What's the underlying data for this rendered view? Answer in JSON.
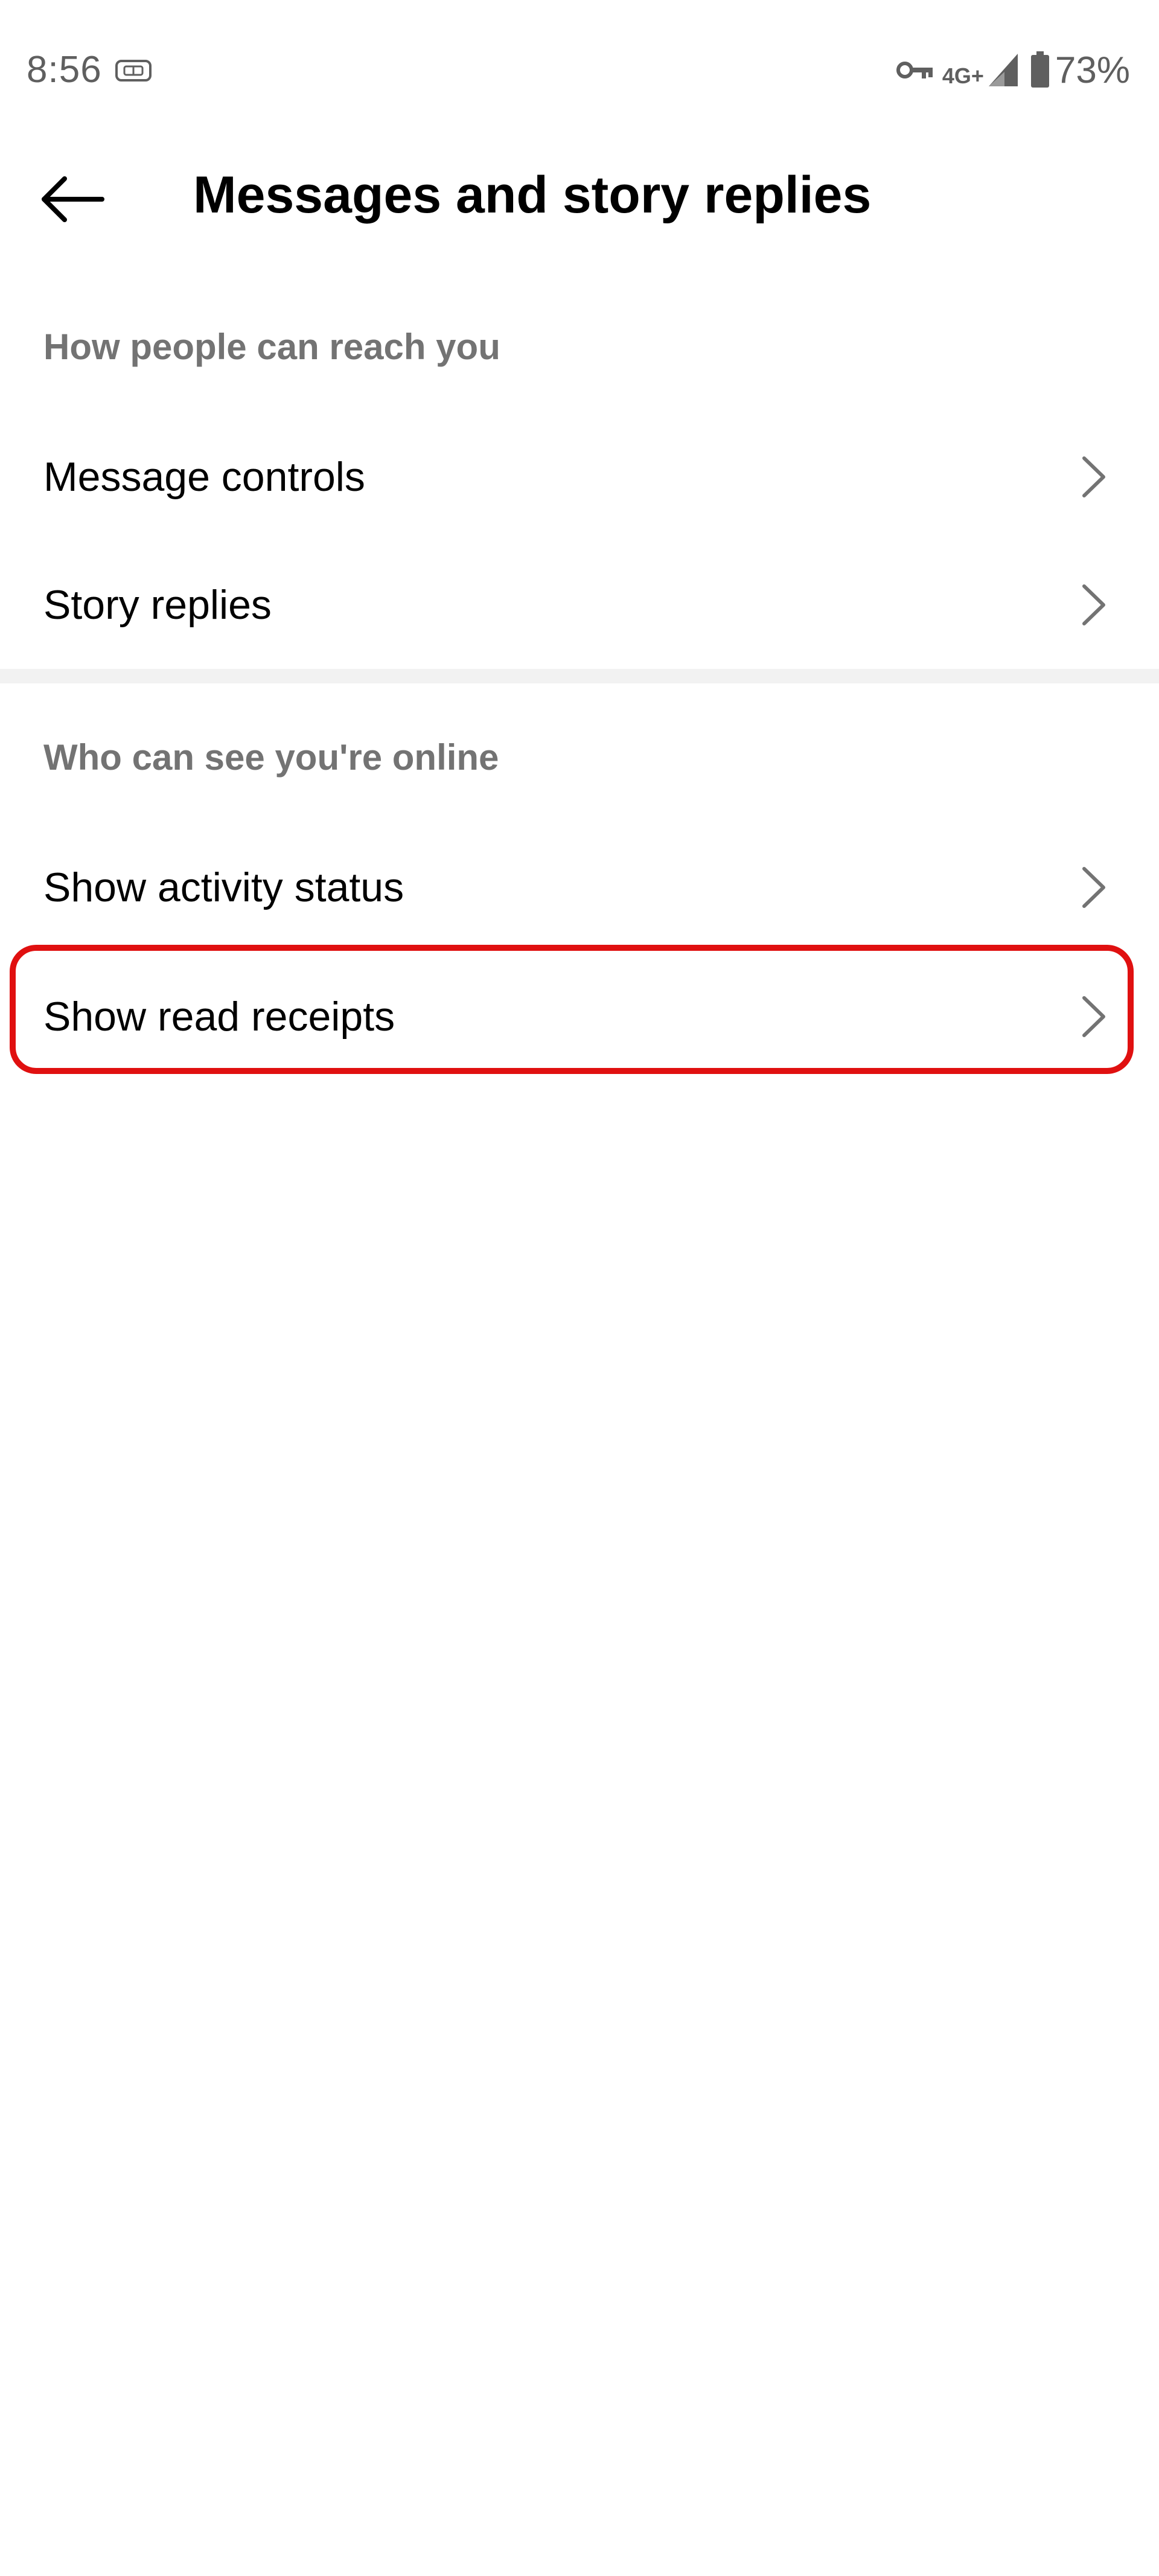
{
  "status_bar": {
    "time": "8:56",
    "network": "4G+",
    "battery": "73%",
    "icons": [
      "sim-card-icon",
      "vpn-key-icon",
      "signal-icon",
      "battery-icon"
    ]
  },
  "header": {
    "title": "Messages and story replies",
    "back_icon": "arrow-left-icon"
  },
  "sections": [
    {
      "header": "How people can reach you",
      "items": [
        {
          "label": "Message controls"
        },
        {
          "label": "Story replies"
        }
      ]
    },
    {
      "header": "Who can see you're online",
      "items": [
        {
          "label": "Show activity status"
        },
        {
          "label": "Show read receipts"
        }
      ]
    }
  ],
  "highlight": {
    "target": "Show read receipts",
    "color": "#e01010"
  },
  "colors": {
    "background": "#ffffff",
    "section_header": "#737373",
    "divider": "#f2f2f2",
    "chevron": "#737373"
  }
}
